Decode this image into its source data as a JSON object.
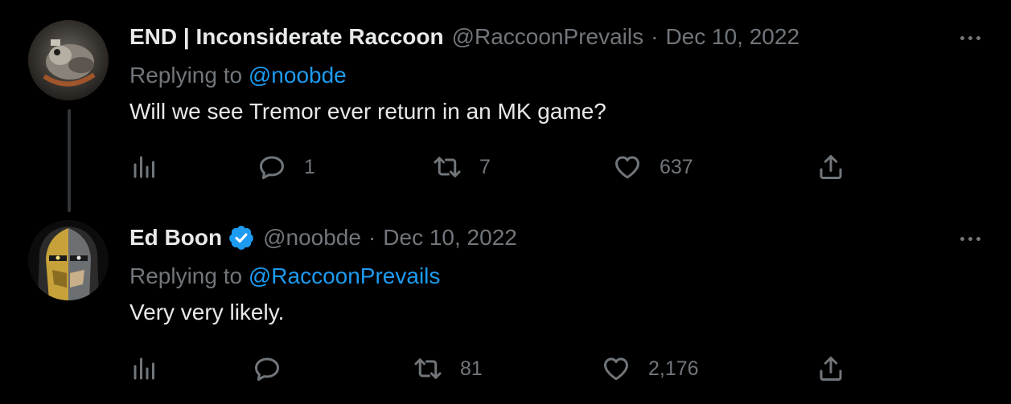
{
  "tweets": [
    {
      "display_name": "END | Inconsiderate Raccoon",
      "handle": "@RaccoonPrevails",
      "separator": "·",
      "date": "Dec 10, 2022",
      "replying_label": "Replying to",
      "replying_to": "@noobde",
      "text": "Will we see Tremor ever return in an MK game?",
      "verified": false,
      "counts": {
        "replies": "1",
        "retweets": "7",
        "likes": "637"
      }
    },
    {
      "display_name": "Ed Boon",
      "handle": "@noobde",
      "separator": "·",
      "date": "Dec 10, 2022",
      "replying_label": "Replying to",
      "replying_to": "@RaccoonPrevails",
      "text": "Very very likely.",
      "verified": true,
      "counts": {
        "replies": "",
        "retweets": "81",
        "likes": "2,176"
      }
    }
  ],
  "icons": [
    "more-icon",
    "analytics-icon",
    "reply-icon",
    "retweet-icon",
    "like-icon",
    "share-icon",
    "verified-badge-icon"
  ],
  "colors": {
    "background": "#000000",
    "text": "#e7e9ea",
    "muted": "#71767b",
    "link": "#1d9bf0",
    "verified": "#1d9bf0",
    "thread_line": "#333639"
  }
}
